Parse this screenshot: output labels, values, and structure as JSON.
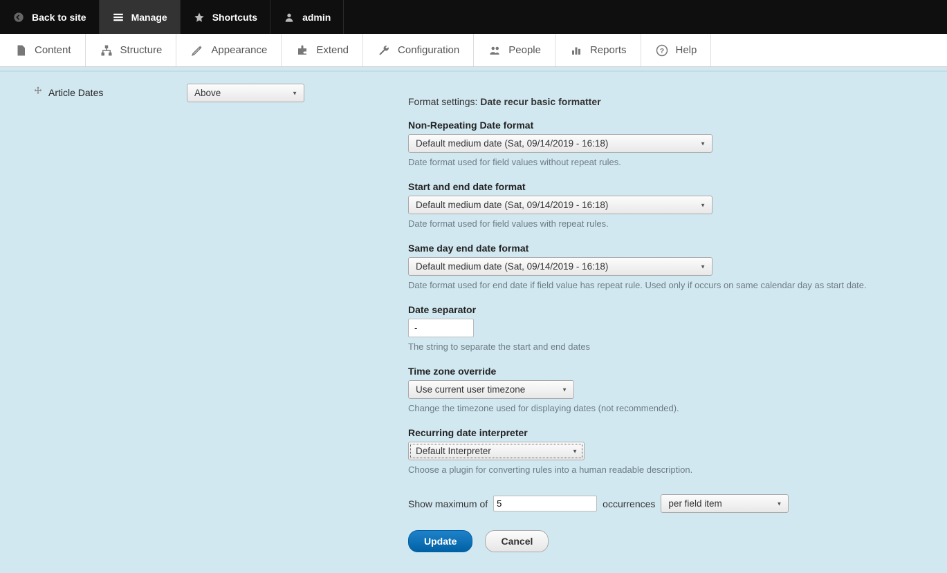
{
  "toolbar": {
    "back": "Back to site",
    "manage": "Manage",
    "shortcuts": "Shortcuts",
    "user": "admin"
  },
  "admin_menu": {
    "content": "Content",
    "structure": "Structure",
    "appearance": "Appearance",
    "extend": "Extend",
    "configuration": "Configuration",
    "people": "People",
    "reports": "Reports",
    "help": "Help"
  },
  "field": {
    "name": "Article Dates",
    "label_position": "Above"
  },
  "format_settings": {
    "prefix": "Format settings: ",
    "name": "Date recur basic formatter",
    "non_repeating": {
      "label": "Non-Repeating Date format",
      "value": "Default medium date (Sat, 09/14/2019 - 16:18)",
      "desc": "Date format used for field values without repeat rules."
    },
    "start_end": {
      "label": "Start and end date format",
      "value": "Default medium date (Sat, 09/14/2019 - 16:18)",
      "desc": "Date format used for field values with repeat rules."
    },
    "same_day": {
      "label": "Same day end date format",
      "value": "Default medium date (Sat, 09/14/2019 - 16:18)",
      "desc": "Date format used for end date if field value has repeat rule. Used only if occurs on same calendar day as start date."
    },
    "separator": {
      "label": "Date separator",
      "value": "-",
      "desc": "The string to separate the start and end dates"
    },
    "timezone": {
      "label": "Time zone override",
      "value": "Use current user timezone",
      "desc": "Change the timezone used for displaying dates (not recommended)."
    },
    "interpreter": {
      "label": "Recurring date interpreter",
      "value": "Default Interpreter",
      "desc": "Choose a plugin for converting rules into a human readable description."
    },
    "show_max": {
      "prefix": "Show maximum of",
      "value": "5",
      "mid": "occurrences",
      "per": "per field item"
    },
    "actions": {
      "update": "Update",
      "cancel": "Cancel"
    }
  }
}
